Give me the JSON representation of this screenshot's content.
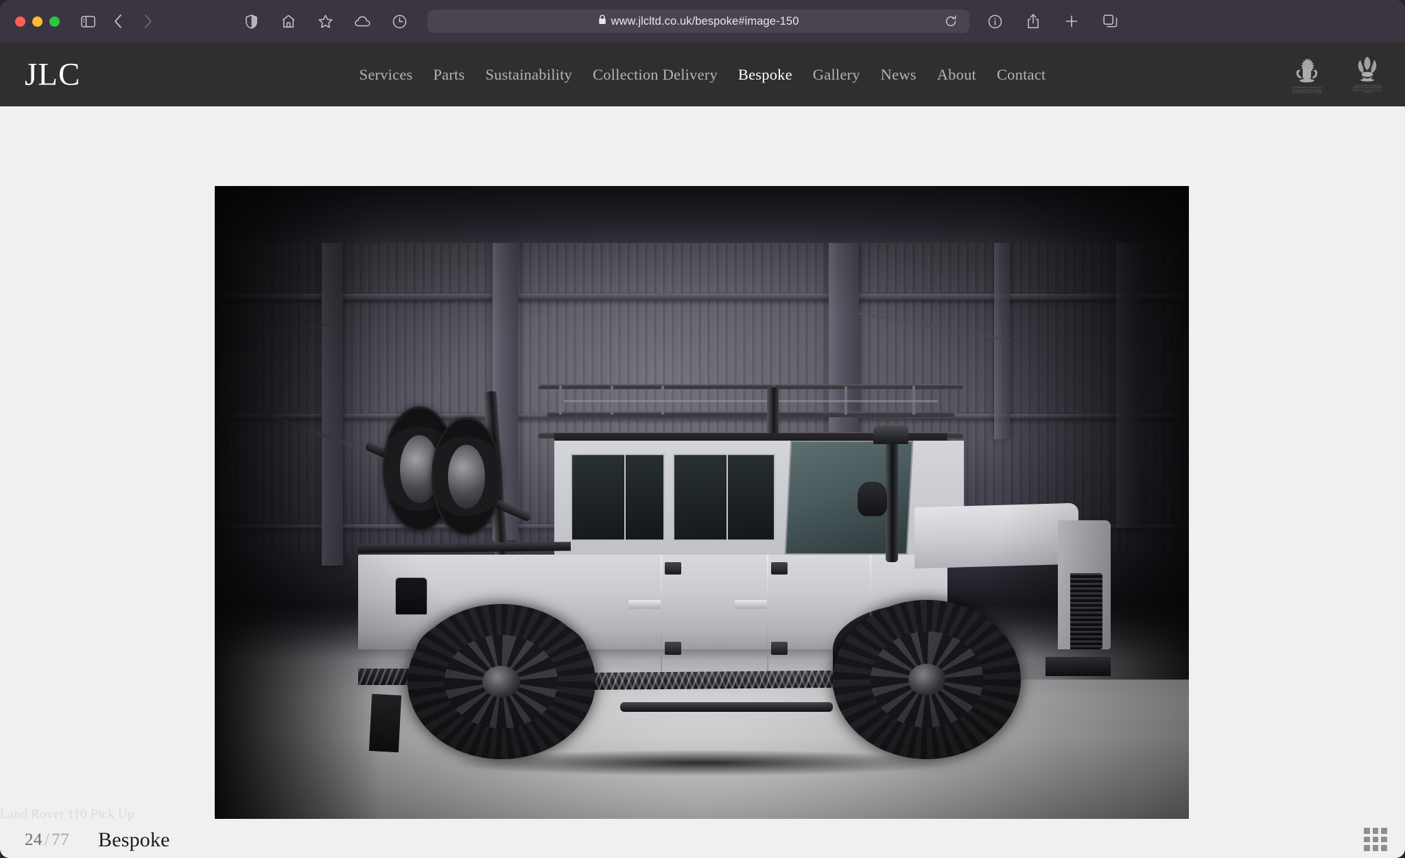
{
  "browser": {
    "url": "www.jlcltd.co.uk/bespoke#image-150",
    "lock_icon": "lock-icon",
    "traffic_lights": [
      "close",
      "minimize",
      "zoom"
    ],
    "left_icons": [
      "sidebar-icon",
      "back-icon",
      "forward-icon"
    ],
    "utility_icons": [
      "shield-icon",
      "home-icon",
      "star-icon",
      "icloud-icon",
      "history-icon"
    ],
    "right_icons": [
      "reload-icon",
      "info-icon",
      "share-icon",
      "new-tab-icon",
      "tab-overview-icon"
    ]
  },
  "site": {
    "logo": "JLC",
    "nav": [
      {
        "label": "Services",
        "active": false
      },
      {
        "label": "Parts",
        "active": false
      },
      {
        "label": "Sustainability",
        "active": false
      },
      {
        "label": "Collection Delivery",
        "active": false
      },
      {
        "label": "Bespoke",
        "active": true
      },
      {
        "label": "Gallery",
        "active": false
      },
      {
        "label": "News",
        "active": false
      },
      {
        "label": "About",
        "active": false
      },
      {
        "label": "Contact",
        "active": false
      }
    ],
    "crests": [
      {
        "name": "royal-warrant-queen-crest",
        "caption": "BY APPOINTMENT TO\nHER MAJESTY\nTHE QUEEN\nSERVICE AND REPAIR OF MOTOR VEHICLES\nJLC LIMITED"
      },
      {
        "name": "royal-warrant-prince-of-wales-crest",
        "caption": "BY APPOINTMENT TO\nHRH THE PRINCE OF WALES\nSERVICE AND REPAIR OF MOTOR VEHICLES\nJLC LIMITED"
      }
    ],
    "header_bg": "#2f2f2f",
    "page_bg": "#f0f0f0"
  },
  "viewer": {
    "image_caption": "Land Rover 110 Pick Up",
    "current_index": "24",
    "separator": "/",
    "total": "77",
    "section_label": "Bespoke",
    "grid_icon": "grid-view-icon",
    "photo_alt": "Silver Land Rover Defender 110 Pick Up with roof rack, roll cage, snorkel and black wheels, photographed side-on inside an industrial workshop"
  }
}
